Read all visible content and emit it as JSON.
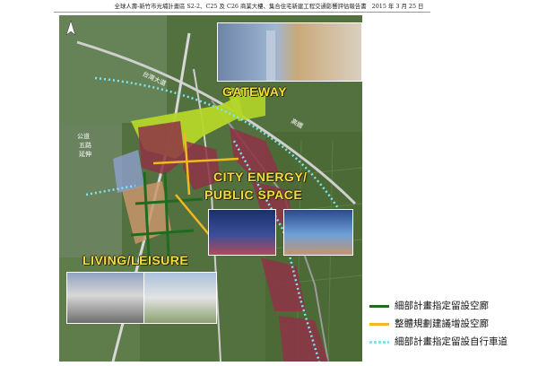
{
  "header": {
    "title": "全球人壽-新竹市光埔計畫區 S2-2、C25 及 C26 商業大樓、集合住宅新建工程交通影響評估報告書",
    "date": "2015 年 3 月 25 日"
  },
  "map": {
    "zones": {
      "gateway": "GATEWAY",
      "city_energy_line1": "CITY ENERGY/",
      "city_energy_line2": "PUBLIC SPACE",
      "living": "LIVING/LEISURE"
    },
    "roads": {
      "highway": "台灣大道",
      "railway": "高鐵",
      "park_label_1": "公道",
      "park_label_2": "五路",
      "park_label_3": "延伸"
    },
    "colors": {
      "development_area": "#8e3347",
      "green_zone": "#b4d629",
      "bike_path": "#7fe5f0",
      "landscape_path": "#f1b81f",
      "reserved_space": "#1f6b1f"
    }
  },
  "legend": {
    "items": [
      {
        "label": "細部計畫指定留設空廊",
        "color": "#1f6b1f",
        "style": "solid"
      },
      {
        "label": "整體規劃建議增設空廊",
        "color": "#f1b81f",
        "style": "solid"
      },
      {
        "label": "細部計畫指定留設自行車道",
        "color": "#7fe5f0",
        "style": "dotted"
      }
    ]
  }
}
